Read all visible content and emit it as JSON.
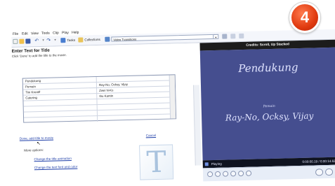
{
  "badge": {
    "number": "4"
  },
  "menu": [
    "File",
    "Edit",
    "View",
    "Tools",
    "Clip",
    "Play",
    "Help"
  ],
  "toolbar": {
    "tasks_label": "Tasks",
    "collections_label": "Collections",
    "collection_value": "Video Transitions"
  },
  "page": {
    "title": "Enter Text for Title",
    "instructions": "Click 'Done' to add the title to the movie."
  },
  "title_grid": {
    "rows": [
      {
        "left": "Pendukung",
        "right": ""
      },
      {
        "left": "Pemain",
        "right": "Ray-No, Ocksy, Vijay"
      },
      {
        "left": "Tim Kreatif",
        "right": "Zwei N-Ks"
      },
      {
        "left": "Catering",
        "right": "Ibu Kantin"
      },
      {
        "left": "",
        "right": ""
      },
      {
        "left": "",
        "right": ""
      },
      {
        "left": "",
        "right": ""
      }
    ]
  },
  "actions": {
    "done": "Done, add title to movie",
    "cancel": "Cancel",
    "more_options": "More options:",
    "change_animation": "Change the title animation",
    "change_font": "Change the text font and color"
  },
  "preview": {
    "header": "Credits: Scroll, Up Stacked",
    "heading": "Pendukung",
    "role": "Pemain",
    "names": "Ray-No, Ocksy, Vijay",
    "status": "Playing",
    "time": "0:00:00.19 / 0:00:14.62"
  },
  "colors": {
    "preview_background": "#454e8f",
    "badge": "#e03a0f",
    "link": "#1f3fa8"
  },
  "icons": [
    "new-project-icon",
    "open-icon",
    "save-icon",
    "undo-icon",
    "redo-icon",
    "tasks-icon",
    "collections-icon",
    "play-icon",
    "stop-icon",
    "rewind-icon",
    "forward-icon",
    "title-T-icon"
  ]
}
